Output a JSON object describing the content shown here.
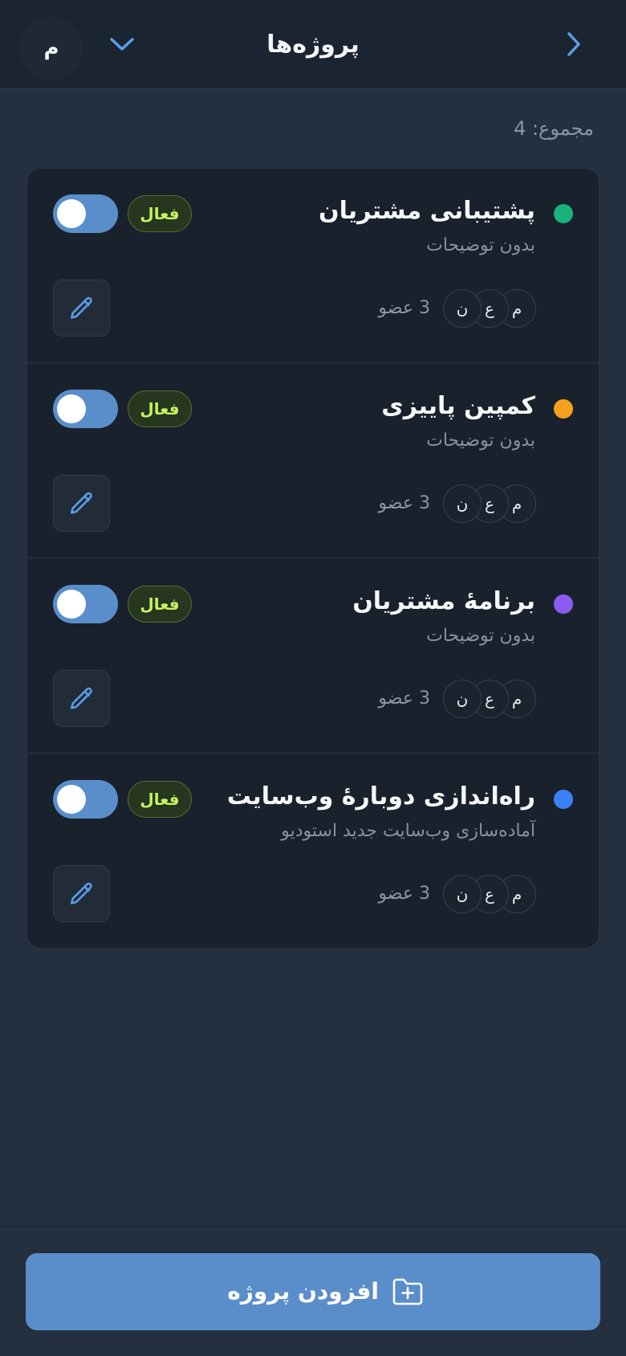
{
  "header": {
    "title": "پروژه‌ها",
    "user_initial": "م",
    "back_icon": "chevron-right-icon",
    "menu_icon": "chevron-down-icon"
  },
  "summary": {
    "total_label": "مجموع: 4"
  },
  "colors": {
    "accent": "#5a8ecb",
    "active_badge_text": "#c6f25f"
  },
  "projects": [
    {
      "name": "پشتیبانی مشتریان",
      "description": "بدون توضیحات",
      "status": "فعال",
      "color": "#19b27a",
      "members_label": "3 عضو",
      "member_initials": [
        "م",
        "ع",
        "ن"
      ],
      "enabled": true
    },
    {
      "name": "کمپین پاییزی",
      "description": "بدون توضیحات",
      "status": "فعال",
      "color": "#f5a11c",
      "members_label": "3 عضو",
      "member_initials": [
        "م",
        "ع",
        "ن"
      ],
      "enabled": true
    },
    {
      "name": "برنامهٔ مشتریان",
      "description": "بدون توضیحات",
      "status": "فعال",
      "color": "#8a5cf0",
      "members_label": "3 عضو",
      "member_initials": [
        "م",
        "ع",
        "ن"
      ],
      "enabled": true
    },
    {
      "name": "راه‌اندازی دوبارهٔ وب‌سایت",
      "description": "آماده‌سازی وب‌سایت جدید استودیو",
      "status": "فعال",
      "color": "#3b82f6",
      "members_label": "3 عضو",
      "member_initials": [
        "م",
        "ع",
        "ن"
      ],
      "enabled": true
    }
  ],
  "footer": {
    "add_label": "افزودن پروژه",
    "add_icon": "folder-plus-icon"
  }
}
